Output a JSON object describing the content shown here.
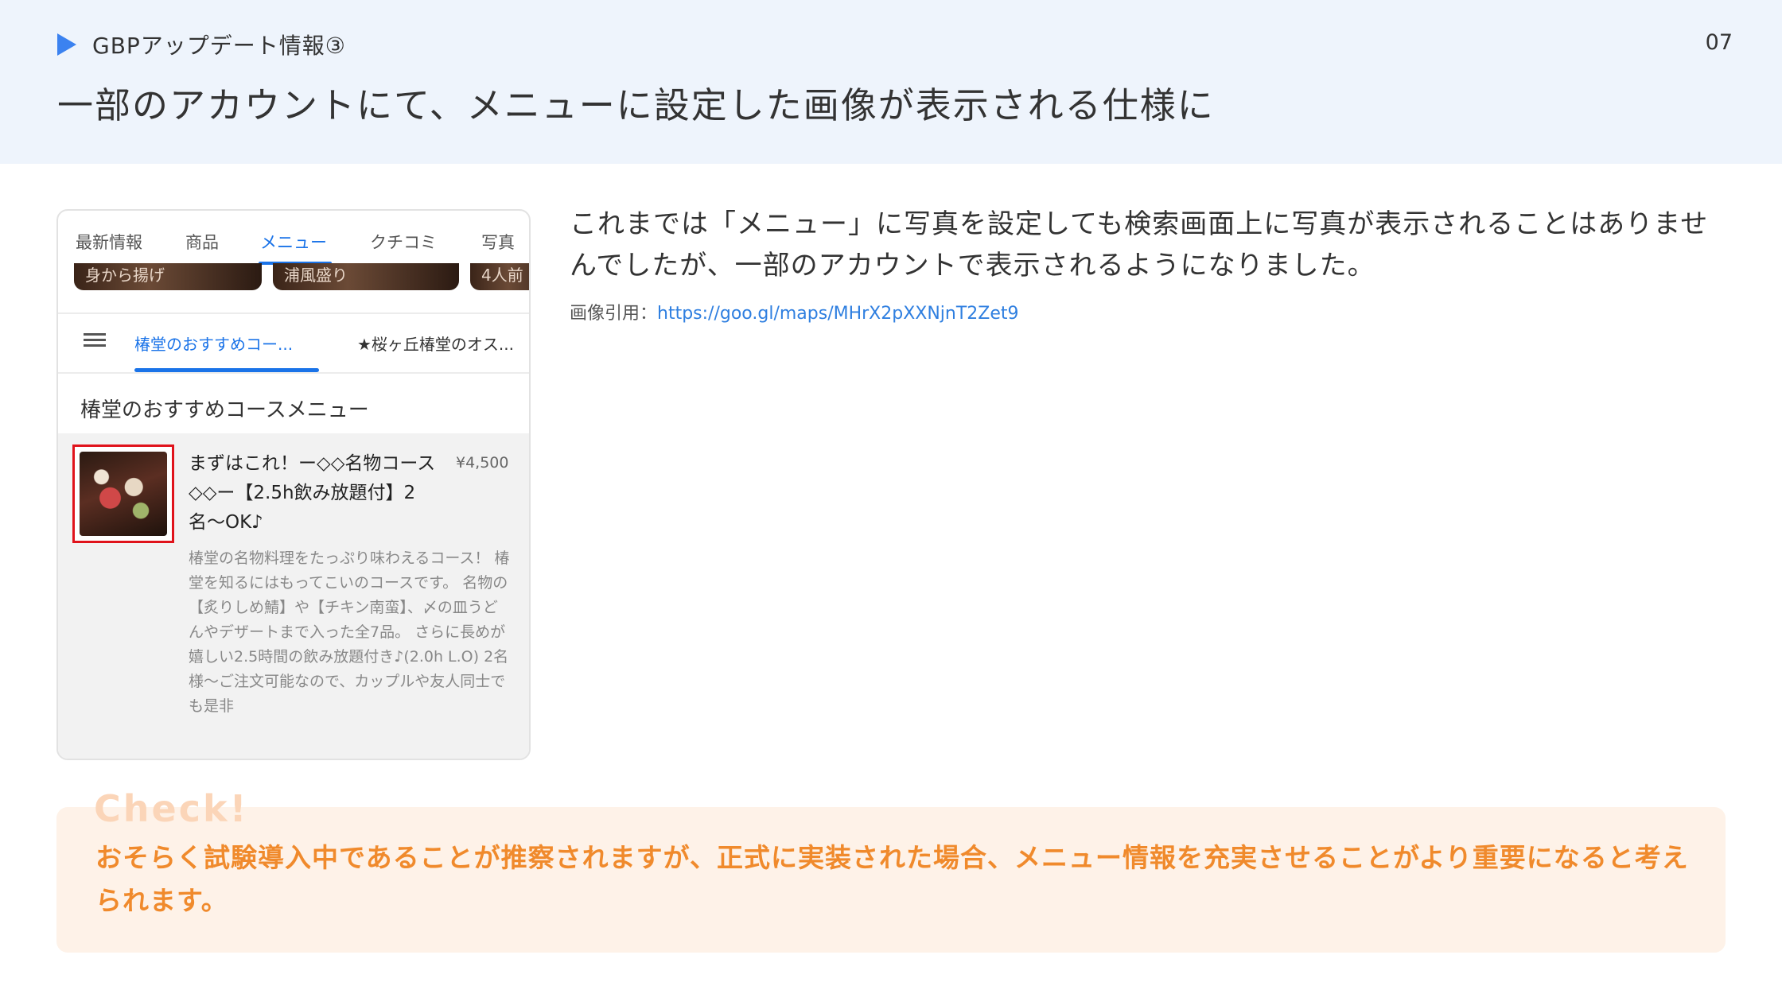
{
  "header": {
    "section_label": "GBPアップデート情報③",
    "page_number": "07",
    "title": "一部のアカウントにて、メニューに設定した画像が表示される仕様に"
  },
  "mock": {
    "tabs": [
      "最新情報",
      "商品",
      "メニュー",
      "クチコミ",
      "写真"
    ],
    "active_tab": "メニュー",
    "thumbnails": [
      "身から揚げ",
      "浦風盛り",
      "4人前"
    ],
    "categories": [
      "椿堂のおすすめコー...",
      "★桜ヶ丘椿堂のオス..."
    ],
    "active_category": "椿堂のおすすめコー...",
    "menu_heading": "椿堂のおすすめコースメニュー",
    "item": {
      "name": "まずはこれ！ー◇◇名物コース◇◇ー【2.5h飲み放題付】2名〜OK♪",
      "price": "¥4,500",
      "description": "椿堂の名物料理をたっぷり味わえるコース！ 椿堂を知るにはもってこいのコースです。 名物の【炙りしめ鯖】や【チキン南蛮】、〆の皿うどんやデザートまで入った全7品。 さらに長めが嬉しい2.5時間の飲み放題付き♪(2.0h L.O) 2名様〜ご注文可能なので、カップルや友人同士でも是非"
    }
  },
  "body": {
    "text": "これまでは「メニュー」に写真を設定しても検索画面上に写真が表示されることはありませんでしたが、一部のアカウントで表示されるようになりました。",
    "citation_label": "画像引用：",
    "citation_url": "https://goo.gl/maps/MHrX2pXXNjnT2Zet9"
  },
  "check": {
    "label": "Check!",
    "text": "おそらく試験導入中であることが推察されますが、正式に実装された場合、メニュー情報を充実させることがより重要になると考えられます。"
  },
  "colors": {
    "accent_blue": "#3b82f0",
    "link_blue": "#2f7fe0",
    "check_orange": "#f08a2c",
    "highlight_red": "#e0131b"
  }
}
